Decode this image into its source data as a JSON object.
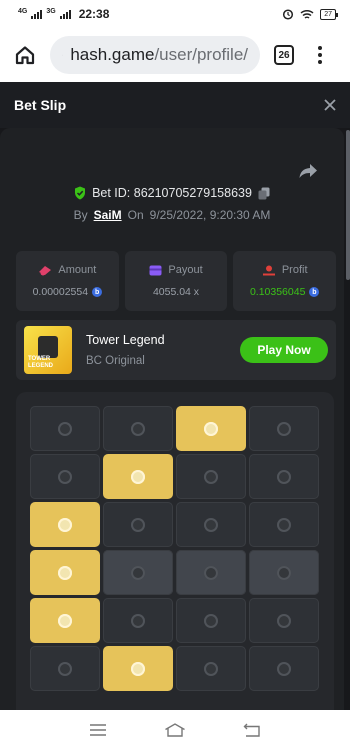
{
  "status_bar": {
    "net1": "4G",
    "net2": "3G",
    "time": "22:38",
    "battery": "27"
  },
  "browser": {
    "url_host": "hash.game",
    "url_path": "/user/profile/",
    "tab_count": "26"
  },
  "header": {
    "title": "Bet Slip"
  },
  "bet": {
    "id_label": "Bet ID: 86210705279158639",
    "by_label": "By",
    "user": "SaiM",
    "on_label": "On",
    "datetime": "9/25/2022, 9:20:30 AM"
  },
  "stats": [
    {
      "label": "Amount",
      "value": "0.00002554",
      "icon": "amount-icon",
      "color": "#e0406a"
    },
    {
      "label": "Payout",
      "value": "4055.04 x",
      "icon": "payout-icon",
      "color": "#8a5cf6"
    },
    {
      "label": "Profit",
      "value": "0.10356045",
      "icon": "profit-icon",
      "color": "#e0403a"
    }
  ],
  "game": {
    "title": "Tower Legend",
    "subtitle": "BC Original",
    "play_label": "Play Now",
    "thumb_text": "TOWER LEGEND"
  },
  "grid": {
    "rows": [
      [
        "dark",
        "dark",
        "gold",
        "dark"
      ],
      [
        "dark",
        "gold",
        "dark",
        "dark"
      ],
      [
        "gold",
        "dark",
        "dark",
        "dark"
      ],
      [
        "gold",
        "shade",
        "shade",
        "shade"
      ],
      [
        "gold",
        "dark",
        "dark",
        "dark"
      ],
      [
        "dark",
        "gold",
        "dark",
        "dark"
      ]
    ]
  },
  "colors": {
    "accent_green": "#3bc117",
    "gold_tile": "#e6c35a",
    "background": "#17181b"
  }
}
